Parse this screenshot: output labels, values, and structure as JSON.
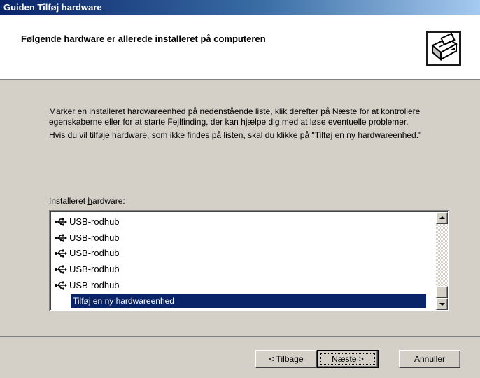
{
  "window": {
    "title": "Guiden Tilføj hardware"
  },
  "header": {
    "title": "Følgende hardware er allerede installeret på computeren",
    "icon": "hardware-wizard-icon"
  },
  "intro": {
    "paragraph1": "Marker en installeret hardwareenhed på nedenstående liste, klik derefter på Næste for at kontrollere egenskaberne eller for at starte Fejlfinding, der kan hjælpe dig med at løse eventuelle problemer.",
    "paragraph2": "Hvis du vil tilføje hardware, som ikke findes på listen, skal du klikke på \"Tilføj en ny hardwareenhed.\""
  },
  "hardware_list": {
    "label_prefix": "Installeret ",
    "label_accel": "h",
    "label_suffix": "ardware:",
    "items": [
      {
        "label": "USB-rodhub",
        "icon": "usb-icon"
      },
      {
        "label": "USB-rodhub",
        "icon": "usb-icon"
      },
      {
        "label": "USB-rodhub",
        "icon": "usb-icon"
      },
      {
        "label": "USB-rodhub",
        "icon": "usb-icon"
      },
      {
        "label": "USB-rodhub",
        "icon": "usb-icon"
      }
    ],
    "selected_item": "Tilføj en ny hardwareenhed",
    "selection_color": "#0a246a"
  },
  "buttons": {
    "back_prefix": "< ",
    "back_accel": "T",
    "back_suffix": "ilbage",
    "next_accel": "N",
    "next_suffix": "æste >",
    "cancel": "Annuller"
  },
  "colors": {
    "dialog_face": "#d4d0c8",
    "titlebar_start": "#0a246a",
    "titlebar_end": "#a6caf0"
  }
}
